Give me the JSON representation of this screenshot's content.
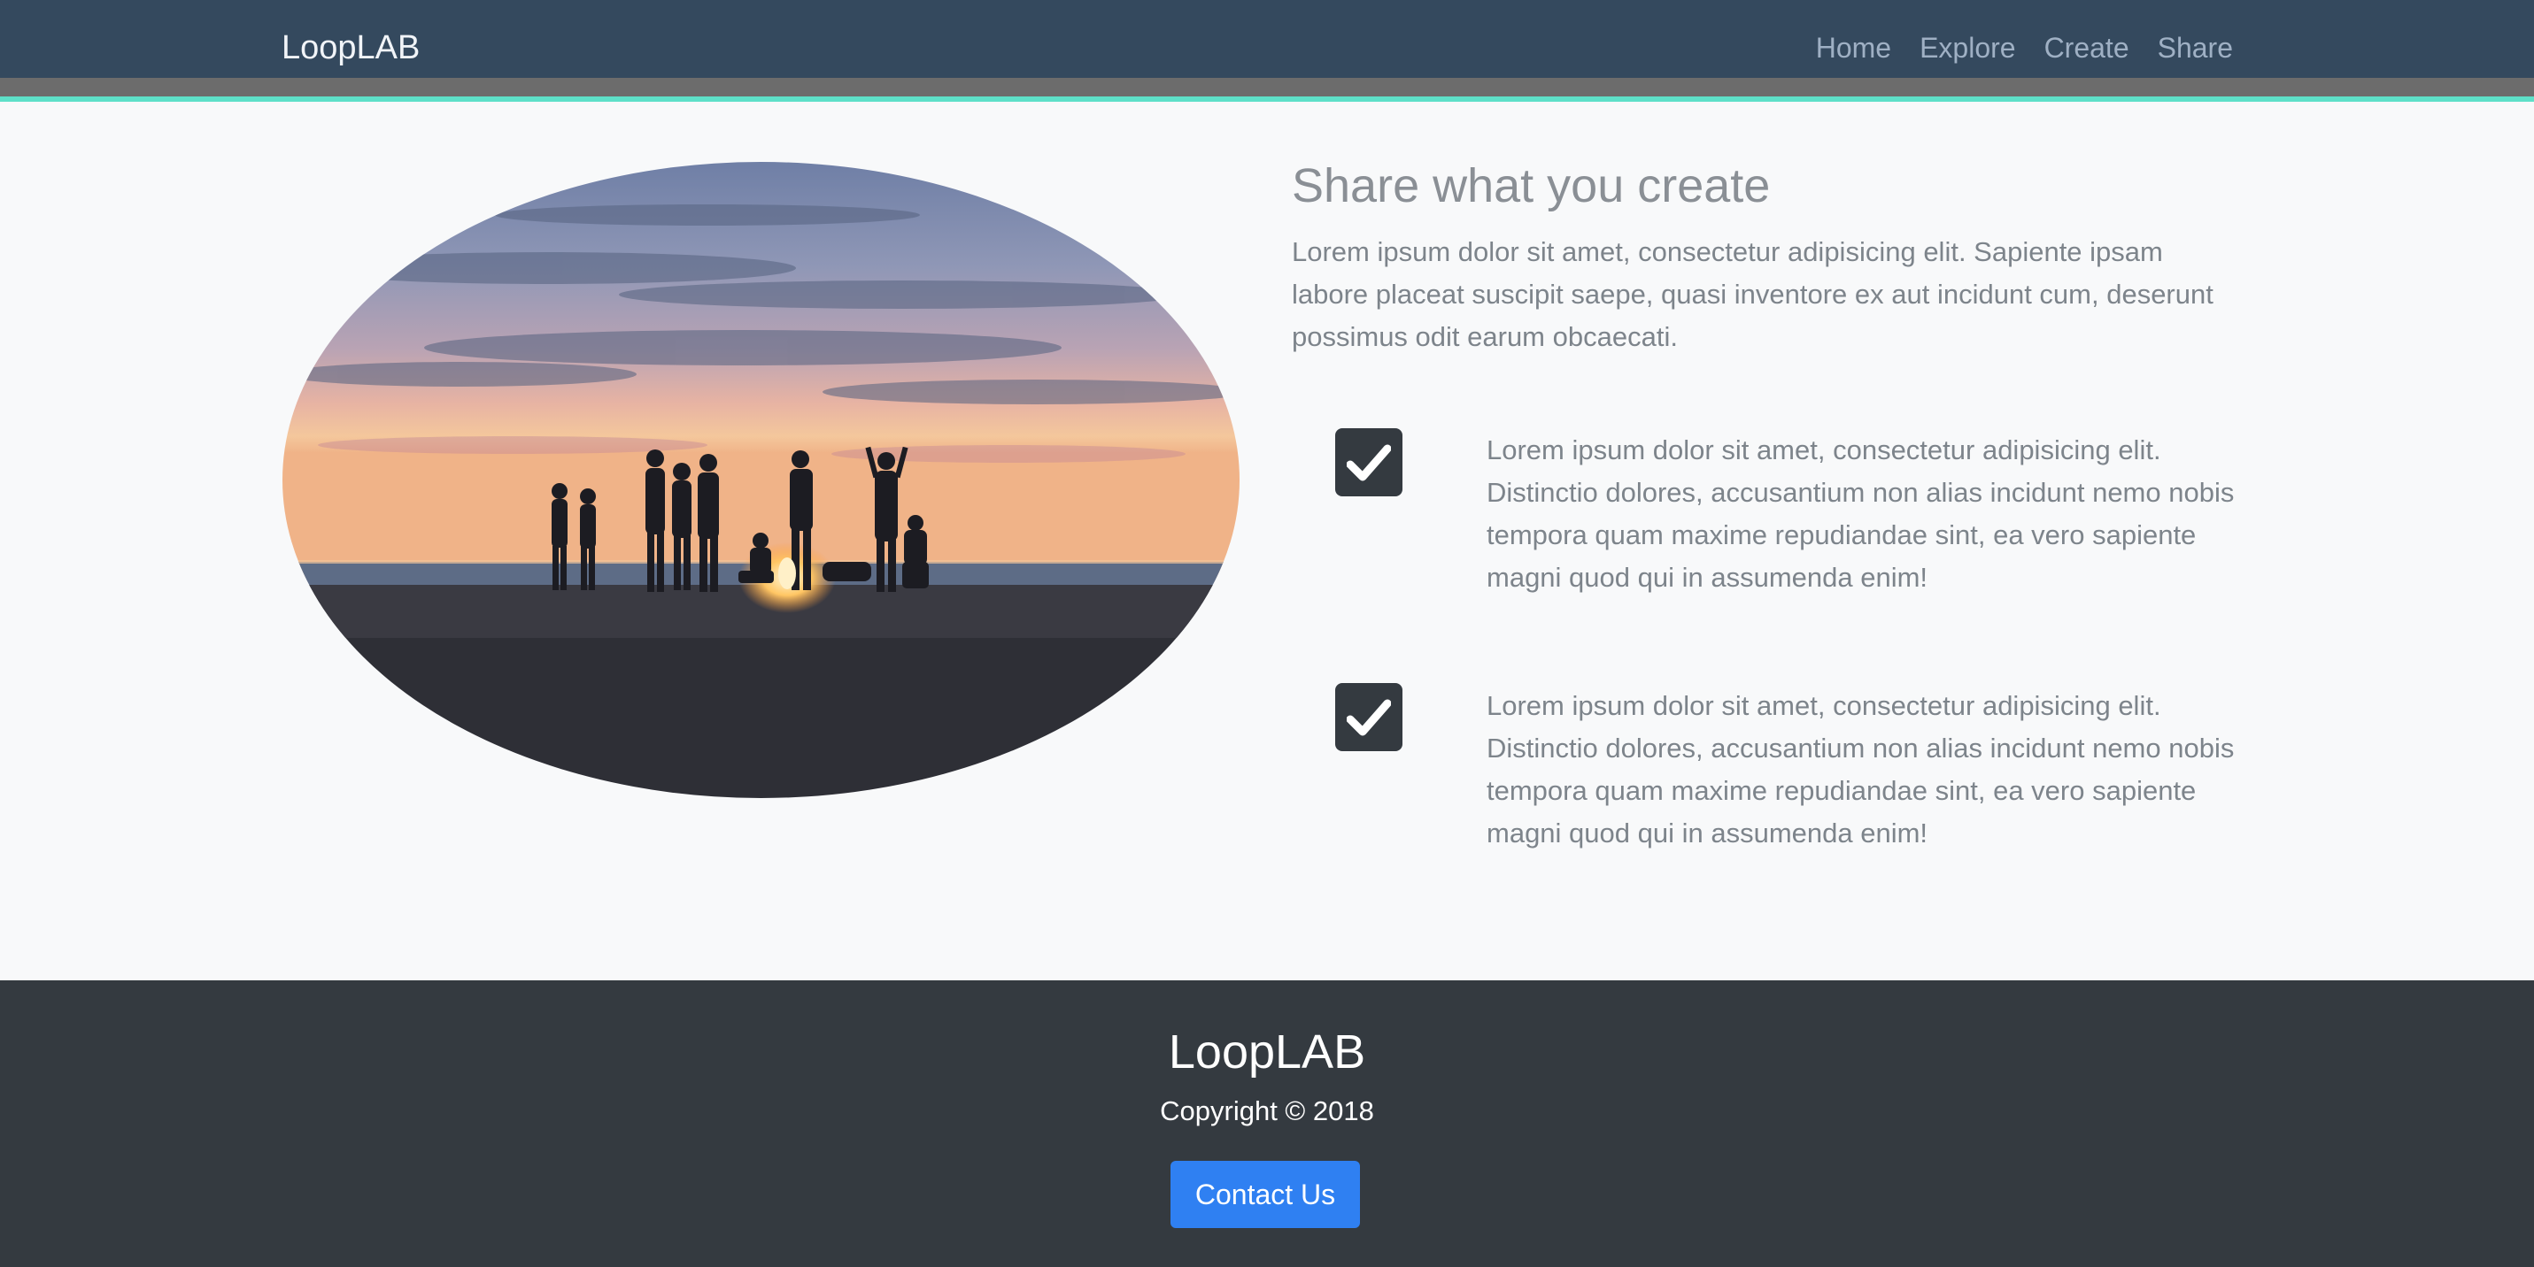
{
  "navbar": {
    "brand": "LoopLAB",
    "links": [
      {
        "label": "Home"
      },
      {
        "label": "Explore"
      },
      {
        "label": "Create"
      },
      {
        "label": "Share"
      }
    ]
  },
  "main": {
    "heading": "Share what you create",
    "intro": "Lorem ipsum dolor sit amet, consectetur adipisicing elit. Sapiente ipsam labore placeat suscipit saepe, quasi inventore ex aut incidunt cum, deserunt possimus odit earum obcaecati.",
    "features": [
      {
        "icon": "checkbox-checked-icon",
        "text": "Lorem ipsum dolor sit amet, consectetur adipisicing elit. Distinctio dolores, accusantium non alias incidunt nemo nobis tempora quam maxime repudiandae sint, ea vero sapiente magni quod qui in assumenda enim!"
      },
      {
        "icon": "checkbox-checked-icon",
        "text": "Lorem ipsum dolor sit amet, consectetur adipisicing elit. Distinctio dolores, accusantium non alias incidunt nemo nobis tempora quam maxime repudiandae sint, ea vero sapiente magni quod qui in assumenda enim!"
      }
    ]
  },
  "footer": {
    "brand": "LoopLAB",
    "copyright": "Copyright © 2018",
    "contact_label": "Contact Us"
  },
  "colors": {
    "navbar_bg": "#34495e",
    "accent_stripe": "#5ee0c8",
    "footer_bg": "#343a40",
    "button_blue": "#2f80f2"
  }
}
